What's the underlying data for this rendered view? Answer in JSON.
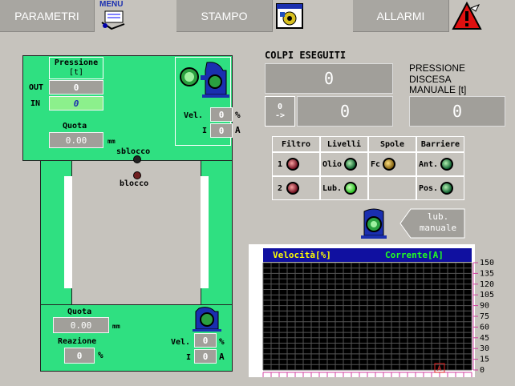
{
  "topbar": {
    "parametri": "PARAMETRI",
    "menu": "MENU",
    "stampo": "STAMPO",
    "allarmi": "ALLARMI"
  },
  "press": {
    "pressione_label": "Pressione",
    "pressione_unit": "[t]",
    "out_label": "OUT",
    "out_value": "0",
    "in_label": "IN",
    "in_value": "0",
    "quota_label": "Quota",
    "quota_value": "0.00",
    "quota_unit": "mm",
    "vel_label": "Vel.",
    "vel_value": "0",
    "vel_unit": "%",
    "i_label": "I",
    "i_value": "0",
    "i_unit": "A",
    "sblocco": "sblocco",
    "blocco": "blocco"
  },
  "lower": {
    "quota_label": "Quota",
    "quota_value": "0.00",
    "quota_unit": "mm",
    "reazione_label": "Reazione",
    "reazione_value": "0",
    "reazione_unit": "%",
    "vel_label": "Vel.",
    "vel_value": "0",
    "vel_unit": "%",
    "i_label": "I",
    "i_value": "0",
    "i_unit": "A"
  },
  "colpi": {
    "title": "COLPI ESEGUITI",
    "value": "0",
    "reset_label_top": "0",
    "reset_label_bottom": "->",
    "partial": "0"
  },
  "pressione_discesa": {
    "line1": "PRESSIONE",
    "line2": "DISCESA",
    "line3": "MANUALE [t]",
    "value": "0"
  },
  "status_table": {
    "headers": [
      "Filtro",
      "Livelli",
      "Spole",
      "Barriere"
    ],
    "row1": {
      "filtro": "1",
      "livelli": "Olio",
      "spole": "Fc",
      "barriere": "Ant."
    },
    "row2": {
      "filtro": "2",
      "livelli": "Lub.",
      "barriere": "Pos."
    }
  },
  "lub": {
    "line1": "lub.",
    "line2": "manuale"
  },
  "chart_data": {
    "type": "line",
    "legend": [
      "Velocità[%]",
      "Corrente[A]"
    ],
    "yticks": [
      "150",
      "135",
      "120",
      "105",
      "90",
      "75",
      "60",
      "45",
      "30",
      "15",
      "0"
    ],
    "ylim": [
      0,
      150
    ],
    "grid": true,
    "marker": "A",
    "series": []
  }
}
